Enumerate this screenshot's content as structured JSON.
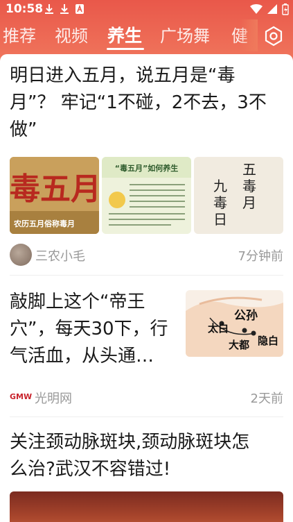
{
  "status_bar": {
    "time": "10:58"
  },
  "tabs": [
    {
      "label": "推荐"
    },
    {
      "label": "视频"
    },
    {
      "label": "养生"
    },
    {
      "label": "广场舞"
    },
    {
      "label": "健"
    }
  ],
  "articles": [
    {
      "title_lines": [
        "明日进入五月，说五月是“毒",
        "月”？ 牢记“1不碰，2不去，3不",
        "做”"
      ],
      "images": [
        {
          "text": "毒五月",
          "caption": "农历五月俗称毒月"
        },
        {
          "text": "“毒五月”如何养生"
        },
        {
          "text_lines": [
            "五",
            "毒",
            "月"
          ],
          "side_lines": [
            "九",
            "毒",
            "日"
          ]
        }
      ],
      "source": "三农小毛",
      "time": "7分钟前"
    },
    {
      "title_lines": [
        "敲脚上这个“帝王",
        "穴”，每天30下，行",
        "气活血，从头通…"
      ],
      "image_labels": [
        "公孙",
        "太白",
        "大都",
        "隐白"
      ],
      "source": "光明网",
      "source_logo": "GMW",
      "time": "2天前"
    },
    {
      "title_lines": [
        "关注颈动脉斑块,颈动脉斑块怎",
        "么治?武汉不容错过!"
      ]
    }
  ],
  "colors": {
    "header": "#e9584a",
    "meta_text": "#999999"
  }
}
